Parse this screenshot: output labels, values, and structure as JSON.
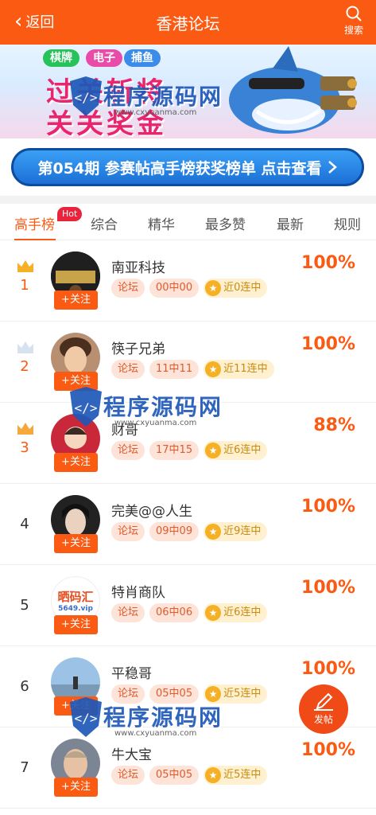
{
  "header": {
    "back_label": "返回",
    "title": "香港论坛",
    "search_label": "搜索"
  },
  "banner": {
    "tags": [
      "棋牌",
      "电子",
      "捕鱼"
    ],
    "slogan_line1": "过关斩将",
    "slogan_line2": "关关奖金"
  },
  "promo": {
    "text": "第054期 参赛帖高手榜获奖榜单 点击查看",
    "icon": "chevron-right-icon"
  },
  "tabs": [
    {
      "label": "高手榜",
      "badge": "Hot"
    },
    {
      "label": "综合"
    },
    {
      "label": "精华"
    },
    {
      "label": "最多赞"
    },
    {
      "label": "最新"
    },
    {
      "label": "规则"
    }
  ],
  "ranking": [
    {
      "rank": "1",
      "crown": "gold",
      "name": "南亚科技",
      "forum": "论坛",
      "record": "00中00",
      "streak": "近0连中",
      "percent": "100%",
      "follow": "+关注"
    },
    {
      "rank": "2",
      "crown": "silver",
      "name": "筷子兄弟",
      "forum": "论坛",
      "record": "11中11",
      "streak": "近11连中",
      "percent": "100%",
      "follow": "+关注"
    },
    {
      "rank": "3",
      "crown": "bronze",
      "name": "财哥",
      "forum": "论坛",
      "record": "17中15",
      "streak": "近6连中",
      "percent": "88%",
      "follow": "+关注"
    },
    {
      "rank": "4",
      "name": "完美@@人生",
      "forum": "论坛",
      "record": "09中09",
      "streak": "近9连中",
      "percent": "100%",
      "follow": "+关注"
    },
    {
      "rank": "5",
      "name": "特肖商队",
      "forum": "论坛",
      "record": "06中06",
      "streak": "近6连中",
      "percent": "100%",
      "follow": "+关注",
      "avatar_text1": "晒码汇",
      "avatar_text2": "5649.vip"
    },
    {
      "rank": "6",
      "name": "平稳哥",
      "forum": "论坛",
      "record": "05中05",
      "streak": "近5连中",
      "percent": "100%",
      "follow": "+关注"
    },
    {
      "rank": "7",
      "name": "牛大宝",
      "forum": "论坛",
      "record": "05中05",
      "streak": "近5连中",
      "percent": "100%",
      "follow": "+关注"
    }
  ],
  "fab": {
    "label": "发帖",
    "icon": "pencil-icon"
  },
  "watermark": {
    "text": "程序源码网",
    "url": "www.cxyuanma.com"
  },
  "colors": {
    "primary": "#fb5a13",
    "promo_blue": "#1c6fd6",
    "hot_red": "#e8233b"
  }
}
